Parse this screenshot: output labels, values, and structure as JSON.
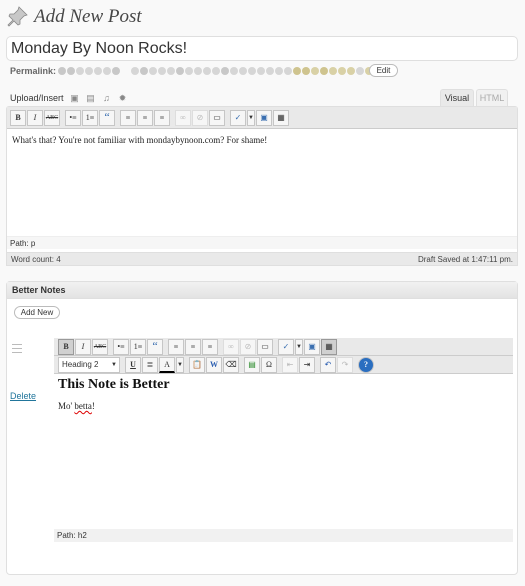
{
  "page": {
    "title": "Add New Post"
  },
  "post": {
    "title_value": "Monday By Noon Rocks!",
    "permalink_label": "Permalink:",
    "edit_label": "Edit"
  },
  "media": {
    "upload_label": "Upload/Insert"
  },
  "editor": {
    "tabs": {
      "visual": "Visual",
      "html": "HTML"
    },
    "content": "What's that? You're not familiar with mondaybynoon.com? For shame!",
    "path": "Path: p",
    "word_count": "Word count: 4",
    "draft_status": "Draft Saved at 1:47:11 pm."
  },
  "notes_box": {
    "title": "Better Notes",
    "add_new_label": "Add New",
    "delete_label": "Delete",
    "format_select": "Heading 2",
    "note_heading": "This Note is Better",
    "note_text_prefix": "Mo' ",
    "note_text_word": "betta",
    "note_text_suffix": "!",
    "path": "Path: h2"
  },
  "toolbar_glyphs": {
    "bold": "B",
    "italic": "I",
    "strike": "ABC",
    "ul": "•≡",
    "ol": "1≡",
    "quote": "“",
    "align_left": "≡",
    "align_center": "≡",
    "align_right": "≡",
    "link": "∞",
    "unlink": "⊘",
    "more": "▭",
    "spell": "✓",
    "fullscreen": "▣",
    "kitchen": "▦",
    "underline": "U",
    "justify": "≣",
    "color": "A",
    "paste_text": "📋",
    "paste_word": "W",
    "clear": "⌫",
    "media": "▤",
    "char": "Ω",
    "outdent": "⇤",
    "indent": "⇥",
    "undo": "↶",
    "redo": "↷",
    "help": "?"
  },
  "colors": {
    "accent_link": "#21759b",
    "toolbar_bg": "#e9e9e9"
  }
}
